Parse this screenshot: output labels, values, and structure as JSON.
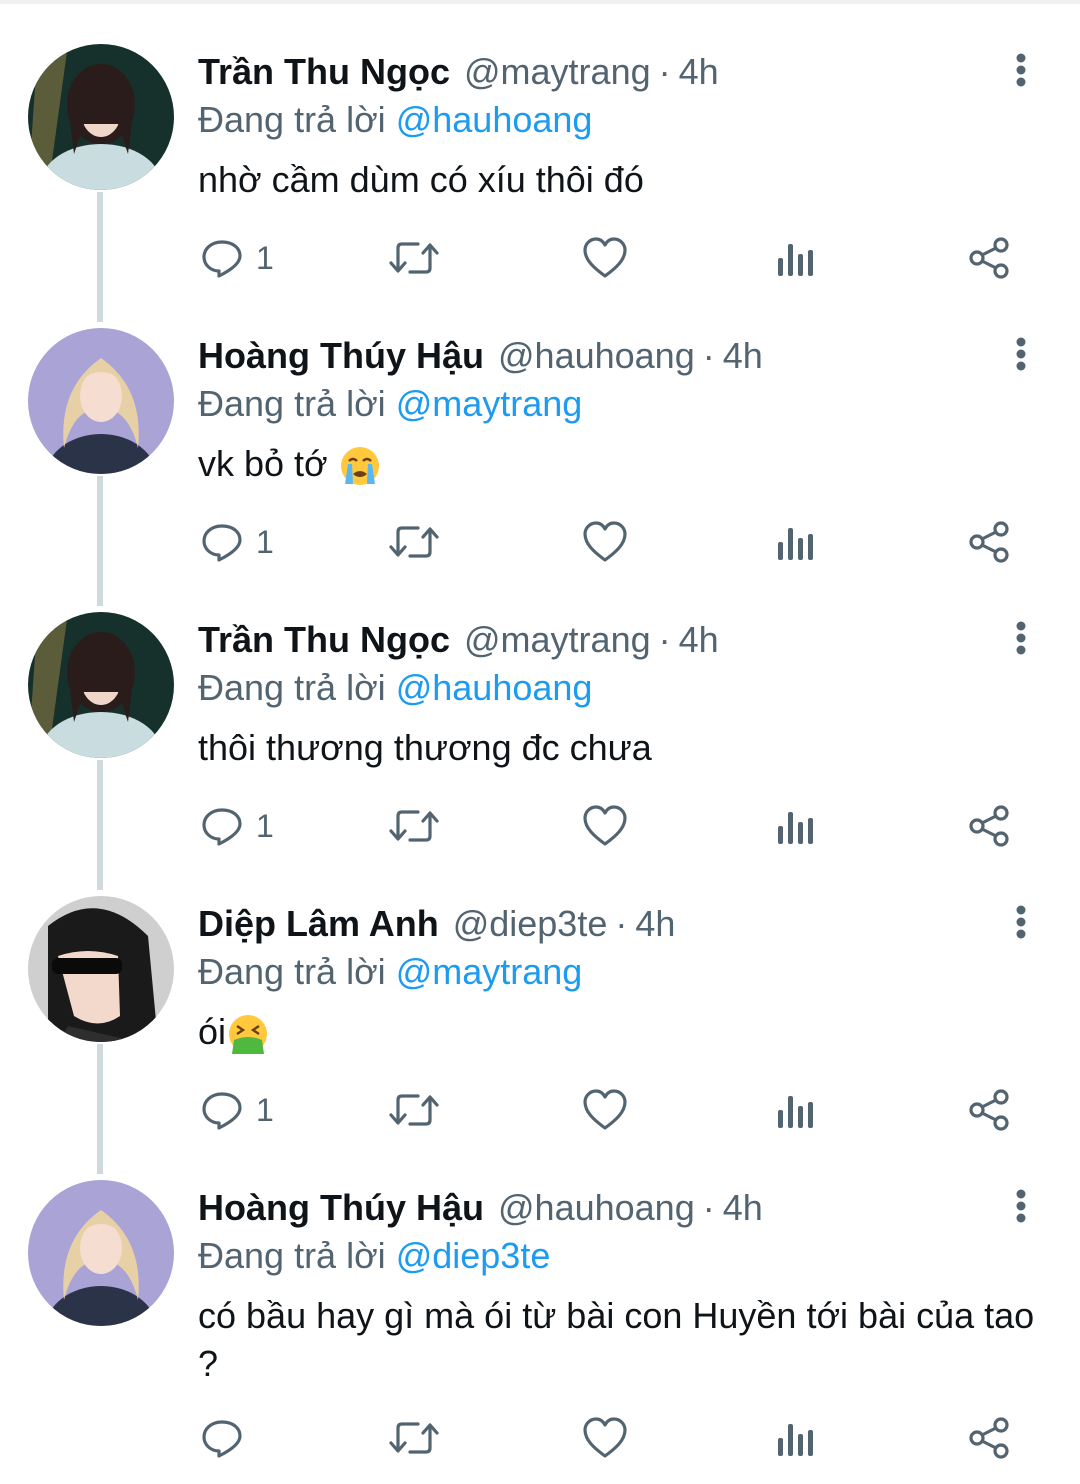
{
  "app": {
    "label_reply_prefix": "Đang trả lời"
  },
  "tweets": [
    {
      "name": "Trần Thu Ngọc",
      "handle": "@maytrang",
      "sep": "·",
      "time": "4h",
      "reply_prefix": "Đang trả lời",
      "reply_to": "@hauhoang",
      "text": "nhờ cầm dùm có xíu thôi đó",
      "reply_count": "1",
      "avatar": "avatar-tran-thu-ngoc"
    },
    {
      "name": "Hoàng Thúy Hậu",
      "handle": "@hauhoang",
      "sep": "·",
      "time": "4h",
      "reply_prefix": "Đang trả lời",
      "reply_to": "@maytrang",
      "text": "vk bỏ tớ",
      "emoji": "loudly-crying-face",
      "reply_count": "1",
      "avatar": "avatar-hoang-thuy-hau"
    },
    {
      "name": "Trần Thu Ngọc",
      "handle": "@maytrang",
      "sep": "·",
      "time": "4h",
      "reply_prefix": "Đang trả lời",
      "reply_to": "@hauhoang",
      "text": "thôi thương thương đc chưa",
      "reply_count": "1",
      "avatar": "avatar-tran-thu-ngoc"
    },
    {
      "name": "Diệp Lâm Anh",
      "handle": "@diep3te",
      "sep": "·",
      "time": "4h",
      "reply_prefix": "Đang trả lời",
      "reply_to": "@maytrang",
      "text": "ói",
      "emoji": "face-vomiting",
      "reply_count": "1",
      "avatar": "avatar-diep-lam-anh"
    },
    {
      "name": "Hoàng Thúy Hậu",
      "handle": "@hauhoang",
      "sep": "·",
      "time": "4h",
      "reply_prefix": "Đang trả lời",
      "reply_to": "@diep3te",
      "text": "có bầu hay gì mà ói từ bài con Huyền tới bài của tao ?",
      "reply_count": "",
      "avatar": "avatar-hoang-thuy-hau"
    }
  ],
  "colors": {
    "mention": "#1d9bf0",
    "secondary": "#536471",
    "thread_line": "#cfd9de"
  },
  "icons": [
    "reply-icon",
    "retweet-icon",
    "like-icon",
    "analytics-icon",
    "share-icon",
    "more-icon"
  ]
}
